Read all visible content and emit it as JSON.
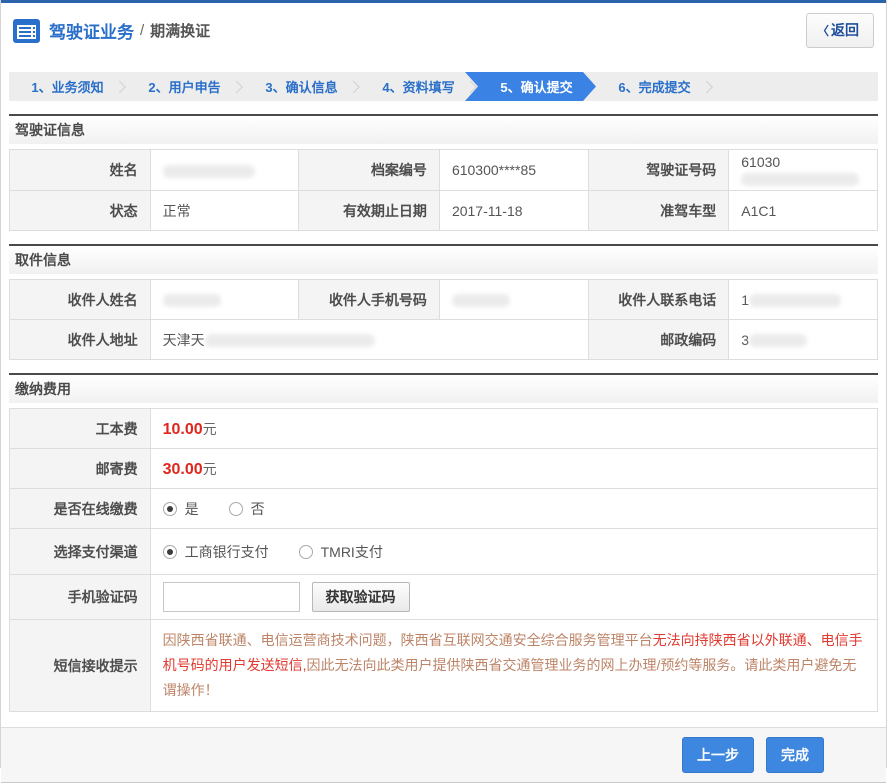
{
  "page": {
    "title_primary": "驾驶证业务",
    "title_separator": "/",
    "title_secondary": "期满换证",
    "back_chevron": "〈",
    "back_label": "返回"
  },
  "steps": {
    "items": [
      {
        "label": "1、业务须知",
        "active": false
      },
      {
        "label": "2、用户申告",
        "active": false
      },
      {
        "label": "3、确认信息",
        "active": false
      },
      {
        "label": "4、资料填写",
        "active": false
      },
      {
        "label": "5、确认提交",
        "active": true
      },
      {
        "label": "6、完成提交",
        "active": false
      }
    ]
  },
  "license_section": {
    "title": "驾驶证信息",
    "name_label": "姓名",
    "name_value": "",
    "file_no_label": "档案编号",
    "file_no_value": "610300****85",
    "license_no_label": "驾驶证号码",
    "license_no_prefix": "61030",
    "status_label": "状态",
    "status_value": "正常",
    "expiry_label": "有效期止日期",
    "expiry_value": "2017-11-18",
    "vehicle_class_label": "准驾车型",
    "vehicle_class_value": "A1C1"
  },
  "pickup_section": {
    "title": "取件信息",
    "recipient_name_label": "收件人姓名",
    "recipient_name_value": "",
    "recipient_mobile_label": "收件人手机号码",
    "recipient_mobile_value": "",
    "recipient_phone_label": "收件人联系电话",
    "recipient_phone_prefix": "1",
    "address_label": "收件人地址",
    "address_prefix": "天津天",
    "postcode_label": "邮政编码",
    "postcode_prefix": "3"
  },
  "fees_section": {
    "title": "缴纳费用",
    "card_fee_label": "工本费",
    "card_fee_value": "10.00",
    "postage_label": "邮寄费",
    "postage_value": "30.00",
    "fee_unit": "元",
    "online_pay_label": "是否在线缴费",
    "online_pay_options": [
      {
        "label": "是",
        "selected": true
      },
      {
        "label": "否",
        "selected": false
      }
    ],
    "channel_label": "选择支付渠道",
    "channel_options": [
      {
        "label": "工商银行支付",
        "selected": true
      },
      {
        "label": "TMRI支付",
        "selected": false
      }
    ],
    "sms_code_label": "手机验证码",
    "sms_code_value": "",
    "get_code_button": "获取验证码",
    "notice_label": "短信接收提示",
    "notice_segments": [
      {
        "text": "因陕西省联通、电信运营商技术问题，陕西省互联网交通安全综合服务管理平台",
        "emphasis": false
      },
      {
        "text": "无法向持陕西省以外联通、电信手机号码的用户发送短信,",
        "emphasis": true
      },
      {
        "text": "因此无法向此类用户提供陕西省交通管理业务的网上办理/预约等服务。请此类用户避免无谓操作！",
        "emphasis": false
      }
    ]
  },
  "footer": {
    "prev_button": "上一步",
    "finish_button": "完成"
  },
  "colors": {
    "accent_blue": "#2a6fc9",
    "step_active_blue": "#3a82e3",
    "top_border_blue": "#2b63ad",
    "fee_red": "#e0251b",
    "notice_red": "#e23a30",
    "notice_muted": "#bd8468",
    "label_cell_bg": "#f4f4f4"
  }
}
